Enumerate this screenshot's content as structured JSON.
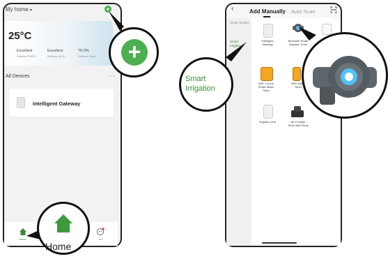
{
  "left_screen": {
    "home_title": "My home",
    "weather": {
      "temperature": "25°C",
      "stats": [
        {
          "value": "Excellent",
          "label": "Outdoor PM2.5"
        },
        {
          "value": "Excellent",
          "label": "Outdoor Air Q..."
        },
        {
          "value": "76.0%",
          "label": "Outdoor Humi..."
        }
      ]
    },
    "devices_heading": "All Devices",
    "more_label": "···",
    "device_name": "Intelligent Gateway",
    "nav": {
      "home_label": "Home",
      "me_label": "Me"
    },
    "zoom_home_label": "Home"
  },
  "right_screen": {
    "tabs": {
      "active": "Add Manually",
      "other": "Auto Scan"
    },
    "sidebar": {
      "item1": "Smart Socket",
      "item2": "Smart Irrigation"
    },
    "products": [
      "Intelligent Gateway",
      "Bluetooth Smart Irrigation Timer",
      "WiFi 2-Zone Smart Water Timer",
      "WiFi Water Timer",
      "Irrigation Hub",
      "Wi-Fi Water Timer with Pump"
    ],
    "zoom_label": "Smart Irrigation"
  },
  "colors": {
    "accent_green": "#4caf50",
    "label_green": "#3a8a3a"
  }
}
